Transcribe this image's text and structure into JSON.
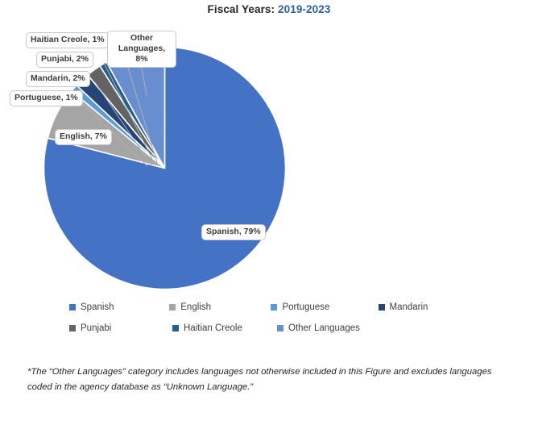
{
  "title": {
    "main": "Fiscal Years:",
    "years": "2019-2023"
  },
  "chart_data": {
    "type": "pie",
    "title": "Fiscal Years: 2019-2023",
    "legend_position": "bottom",
    "categories": [
      "Spanish",
      "English",
      "Portuguese",
      "Mandarin",
      "Punjabi",
      "Haitian Creole",
      "Other Languages"
    ],
    "values": [
      79,
      7,
      1,
      2,
      2,
      1,
      8
    ],
    "value_unit": "percent",
    "data_labels": [
      "Spanish, 79%",
      "English, 7%",
      "Portuguese, 1%",
      "Mandarin, 2%",
      "Punjabi, 2%",
      "Haitian Creole, 1%",
      "Other Languages, 8%"
    ],
    "colors": [
      "#4472C4",
      "#A5A5A5",
      "#5B9BD5",
      "#264478",
      "#636363",
      "#255E91",
      "#698ED0"
    ],
    "slice_order_clockwise_from_top": [
      "Spanish",
      "English",
      "Portuguese",
      "Mandarin",
      "Punjabi",
      "Haitian Creole",
      "Other Languages"
    ],
    "annotation": "*The “Other Languages” category includes languages not otherwise included in this Figure and excludes languages coded in the agency database as “Unknown Language.”"
  },
  "labels": {
    "spanish": "Spanish, 79%",
    "english": "English, 7%",
    "portuguese": "Portuguese, 1%",
    "mandarin": "Mandarin, 2%",
    "punjabi": "Punjabi, 2%",
    "haitian": "Haitian Creole, 1%",
    "other": "Other Languages, 8%"
  },
  "legend": {
    "row1": [
      {
        "label": "Spanish",
        "color": "#4472C4"
      },
      {
        "label": "English",
        "color": "#A5A5A5"
      },
      {
        "label": "Portuguese",
        "color": "#5B9BD5"
      },
      {
        "label": "Mandarin",
        "color": "#264478"
      }
    ],
    "row2": [
      {
        "label": "Punjabi",
        "color": "#636363"
      },
      {
        "label": "Haitian Creole",
        "color": "#255E91"
      },
      {
        "label": "Other Languages",
        "color": "#698ED0"
      }
    ]
  },
  "footnote": {
    "text": "*The “Other Languages” category includes languages not otherwise included in this Figure and excludes languages coded in the agency database as “Unknown Language.”"
  }
}
